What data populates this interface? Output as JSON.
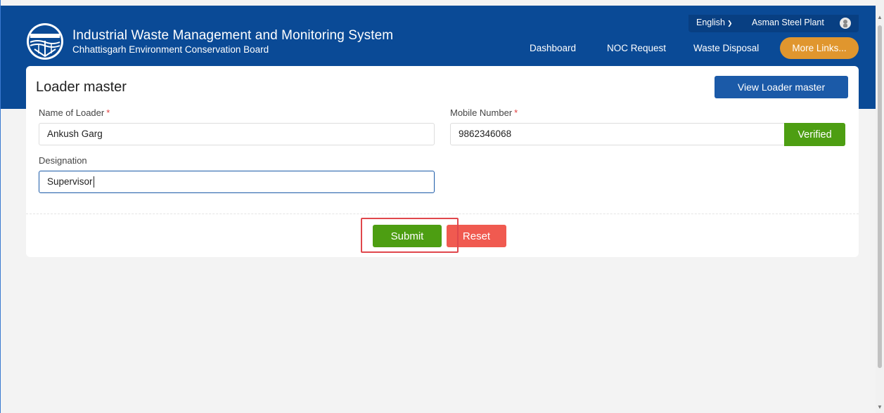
{
  "header": {
    "title": "Industrial Waste Management and Monitoring System",
    "subtitle": "Chhattisgarh Environment Conservation Board",
    "language": "English",
    "user_name": "Asman Steel Plant",
    "nav": [
      "Dashboard",
      "NOC Request",
      "Waste Disposal"
    ],
    "more_links": "More Links..."
  },
  "form": {
    "title": "Loader master",
    "view_button": "View Loader master",
    "name_label": "Name of Loader",
    "name_value": "Ankush Garg",
    "mobile_label": "Mobile Number",
    "mobile_value": "9862346068",
    "verified_label": "Verified",
    "designation_label": "Designation",
    "designation_value": "Supervisor",
    "required_mark": "*",
    "submit_label": "Submit",
    "reset_label": "Reset"
  },
  "colors": {
    "header_bg": "#0a4a96",
    "more_links_bg": "#e0962e",
    "primary_button": "#1b5aa8",
    "success": "#4d9e12",
    "danger": "#f05a50",
    "highlight": "#e0474c"
  }
}
